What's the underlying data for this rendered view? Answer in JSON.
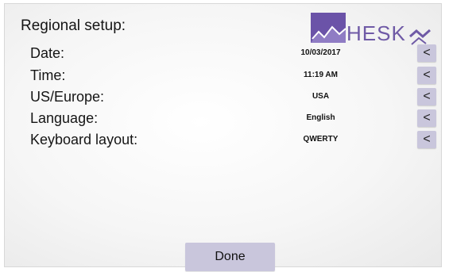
{
  "screen": {
    "title": "Regional setup:"
  },
  "logo": {
    "word": "HESK",
    "accent_color": "#6f5aa6"
  },
  "settings": [
    {
      "label": "Date:",
      "value": "10/03/2017",
      "button": "<"
    },
    {
      "label": "Time:",
      "value": "11:19 AM",
      "button": "<"
    },
    {
      "label": "US/Europe:",
      "value": "USA",
      "button": "<"
    },
    {
      "label": "Language:",
      "value": "English",
      "button": "<"
    },
    {
      "label": "Keyboard layout:",
      "value": "QWERTY",
      "button": "<"
    }
  ],
  "footer": {
    "done_label": "Done"
  },
  "colors": {
    "button_bg": "#c9c6dc"
  }
}
